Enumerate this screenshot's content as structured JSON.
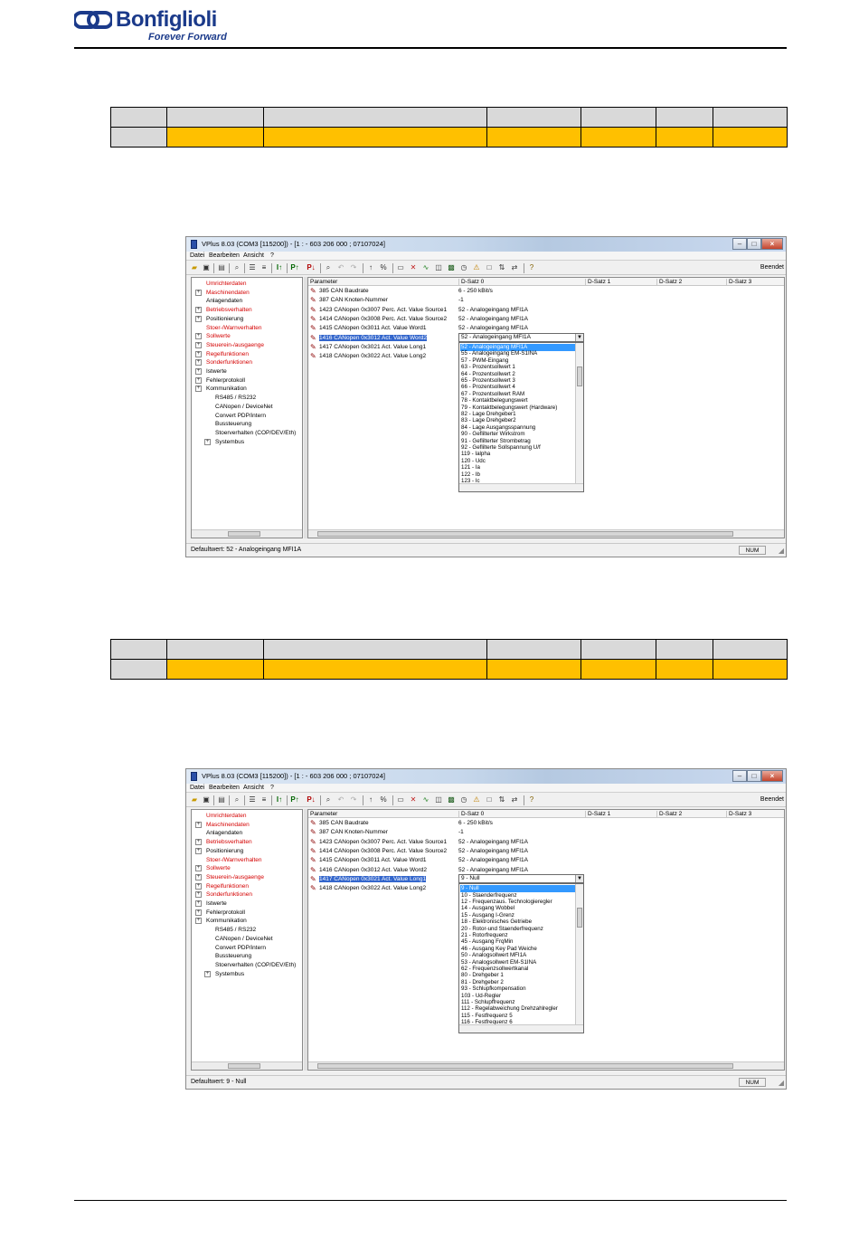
{
  "header": {
    "brand_name": "Bonfiglioli",
    "tagline": "Forever Forward",
    "brand_color": "#1b3a8a"
  },
  "colors": {
    "value_row": "#ffc000",
    "header_row": "#d9d9d9",
    "list_selection": "#3399ff"
  },
  "windows": [
    {
      "title": "VPlus 8.03 (COM3 [115200]) - [1 : -   603 206 000 ; 07107024]",
      "menu": [
        "Datei",
        "Bearbeiten",
        "Ansicht",
        "?"
      ],
      "toolbar_right": "Beendet",
      "tree": [
        {
          "label": "Umrichterdaten",
          "red": true,
          "exp": false,
          "indent": 0
        },
        {
          "label": "Maschinendaten",
          "red": true,
          "exp": true,
          "indent": 0
        },
        {
          "label": "Anlagendaten",
          "red": false,
          "exp": false,
          "indent": 0
        },
        {
          "label": "Betriebsverhalten",
          "red": true,
          "exp": true,
          "indent": 0
        },
        {
          "label": "Positionierung",
          "red": false,
          "exp": true,
          "indent": 0
        },
        {
          "label": "Stoer-/Warnverhalten",
          "red": true,
          "exp": false,
          "indent": 0
        },
        {
          "label": "Sollwerte",
          "red": true,
          "exp": true,
          "indent": 0
        },
        {
          "label": "Steuerein-/ausgaenge",
          "red": true,
          "exp": true,
          "indent": 0
        },
        {
          "label": "Regelfunktionen",
          "red": true,
          "exp": true,
          "indent": 0
        },
        {
          "label": "Sonderfunktionen",
          "red": true,
          "exp": true,
          "indent": 0
        },
        {
          "label": "Istwerte",
          "red": false,
          "exp": true,
          "indent": 0
        },
        {
          "label": "Fehlerprotokoll",
          "red": false,
          "exp": true,
          "indent": 0
        },
        {
          "label": "Kommunikation",
          "red": false,
          "exp": true,
          "indent": 0
        },
        {
          "label": "RS485 / RS232",
          "red": false,
          "exp": false,
          "indent": 1
        },
        {
          "label": "CANopen / DeviceNet",
          "red": false,
          "exp": false,
          "indent": 1
        },
        {
          "label": "Convert PDP/intern",
          "red": false,
          "exp": false,
          "indent": 1
        },
        {
          "label": "Bussteuerung",
          "red": false,
          "exp": false,
          "indent": 1
        },
        {
          "label": "Stoerverhalten (COP/DEV/Eth)",
          "red": false,
          "exp": false,
          "indent": 1
        },
        {
          "label": "Systembus",
          "red": false,
          "exp": true,
          "indent": 1
        }
      ],
      "grid_headers": [
        "Parameter",
        "D-Satz 0",
        "D-Satz 1",
        "D-Satz 2",
        "D-Satz 3"
      ],
      "params": [
        {
          "name": "385  CAN Baudrate",
          "value": "6 - 250 kBit/s"
        },
        {
          "name": "387  CAN Knoten-Nummer",
          "value": "-1"
        },
        {
          "name": "1423  CANopen 0x3007 Perc. Act. Value Source1",
          "value": "52 - Analogeingang MFI1A"
        },
        {
          "name": "1414  CANopen 0x3008 Perc. Act. Value Source2",
          "value": "52 - Analogeingang MFI1A"
        },
        {
          "name": "1415  CANopen 0x3011 Act. Value Word1",
          "value": "52 - Analogeingang MFI1A"
        },
        {
          "name": "1416  CANopen 0x3012 Act. Value Word2",
          "value": ""
        },
        {
          "name": "1417  CANopen 0x3021 Act. Value Long1",
          "value": ""
        },
        {
          "name": "1418  CANopen 0x3022 Act. Value Long2",
          "value": ""
        }
      ],
      "selected_param_index": 5,
      "combo_value": "52 - Analogeingang MFI1A",
      "options": [
        "52 - Analogeingang MFI1A",
        "55 - Analogeingang EM-S1INA",
        "57 - PWM-Eingang",
        "63 - Prozentsollwert 1",
        "64 - Prozentsollwert 2",
        "65 - Prozentsollwert 3",
        "66 - Prozentsollwert 4",
        "67 - Prozentsollwert RAM",
        "78 - Kontaktbelegungswert",
        "79 - Kontaktbelegungswert (Hardware)",
        "82 - Lage Drehgeber1",
        "83 - Lage Drehgeber2",
        "84 - Lage Ausgangsspannung",
        "90 - Geflilterter Wirkstrom",
        "91 - Geflilterter Strombetrag",
        "92 - Geflilterte Sollspannung U/f",
        "119 - Ialpha",
        "120 - Udc",
        "121 - Ia",
        "122 - Ib",
        "123 - Ic"
      ],
      "status_text": "Defaultwert: 52 - Analogeingang MFI1A",
      "status_num": "NUM"
    },
    {
      "title": "VPlus 8.03 (COM3 [115200]) - [1 : -   603 206 000 ; 07107024]",
      "menu": [
        "Datei",
        "Bearbeiten",
        "Ansicht",
        "?"
      ],
      "toolbar_right": "Beendet",
      "tree": [
        {
          "label": "Umrichterdaten",
          "red": true,
          "exp": false,
          "indent": 0
        },
        {
          "label": "Maschinendaten",
          "red": true,
          "exp": true,
          "indent": 0
        },
        {
          "label": "Anlagendaten",
          "red": false,
          "exp": false,
          "indent": 0
        },
        {
          "label": "Betriebsverhalten",
          "red": true,
          "exp": true,
          "indent": 0
        },
        {
          "label": "Positionierung",
          "red": false,
          "exp": true,
          "indent": 0
        },
        {
          "label": "Stoer-/Warnverhalten",
          "red": true,
          "exp": false,
          "indent": 0
        },
        {
          "label": "Sollwerte",
          "red": true,
          "exp": true,
          "indent": 0
        },
        {
          "label": "Steuerein-/ausgaenge",
          "red": true,
          "exp": true,
          "indent": 0
        },
        {
          "label": "Regelfunktionen",
          "red": true,
          "exp": true,
          "indent": 0
        },
        {
          "label": "Sonderfunktionen",
          "red": true,
          "exp": true,
          "indent": 0
        },
        {
          "label": "Istwerte",
          "red": false,
          "exp": true,
          "indent": 0
        },
        {
          "label": "Fehlerprotokoll",
          "red": false,
          "exp": true,
          "indent": 0
        },
        {
          "label": "Kommunikation",
          "red": false,
          "exp": true,
          "indent": 0
        },
        {
          "label": "RS485 / RS232",
          "red": false,
          "exp": false,
          "indent": 1
        },
        {
          "label": "CANopen / DeviceNet",
          "red": false,
          "exp": false,
          "indent": 1
        },
        {
          "label": "Convert PDP/intern",
          "red": false,
          "exp": false,
          "indent": 1
        },
        {
          "label": "Bussteuerung",
          "red": false,
          "exp": false,
          "indent": 1
        },
        {
          "label": "Stoerverhalten (COP/DEV/Eth)",
          "red": false,
          "exp": false,
          "indent": 1
        },
        {
          "label": "Systembus",
          "red": false,
          "exp": true,
          "indent": 1
        }
      ],
      "grid_headers": [
        "Parameter",
        "D-Satz 0",
        "D-Satz 1",
        "D-Satz 2",
        "D-Satz 3"
      ],
      "params": [
        {
          "name": "385  CAN Baudrate",
          "value": "6 - 250 kBit/s"
        },
        {
          "name": "387  CAN Knoten-Nummer",
          "value": "-1"
        },
        {
          "name": "1423  CANopen 0x3007 Perc. Act. Value Source1",
          "value": "52 - Analogeingang MFI1A"
        },
        {
          "name": "1414  CANopen 0x3008 Perc. Act. Value Source2",
          "value": "52 - Analogeingang MFI1A"
        },
        {
          "name": "1415  CANopen 0x3011 Act. Value Word1",
          "value": "52 - Analogeingang MFI1A"
        },
        {
          "name": "1416  CANopen 0x3012 Act. Value Word2",
          "value": "52 - Analogeingang MFI1A"
        },
        {
          "name": "1417  CANopen 0x3021 Act. Value Long1",
          "value": ""
        },
        {
          "name": "1418  CANopen 0x3022 Act. Value Long2",
          "value": ""
        }
      ],
      "selected_param_index": 6,
      "combo_value": "9 - Null",
      "options": [
        "9 - Null",
        "10 - Staenderfrequenz",
        "12 - Frequenzaus. Technologieregler",
        "14 - Ausgang Wobbel",
        "15 - Ausgang I-Grenz",
        "18 - Elektronisches Getriebe",
        "20 - Rotor-und Staenderfrequenz",
        "21 - Rotorfrequenz",
        "45 - Ausgang FrqMin",
        "46 - Ausgang Key Pad Weiche",
        "50 - Analogsollwert MFI1A",
        "53 - Analogsollwert EM-S1INA",
        "62 - Frequenzsollwertkanal",
        "80 - Drehgeber 1",
        "81 - Drehgeber 2",
        "93 - Schlupfkompensation",
        "103 - Ud-Regler",
        "111 - Schlupffrequenz",
        "112 - Regelabweichung Drehzahlregler",
        "115 - Festfrequenz 5",
        "116 - Festfrequenz 6"
      ],
      "status_text": "Defaultwert: 9 - Null",
      "status_num": "NUM"
    }
  ]
}
